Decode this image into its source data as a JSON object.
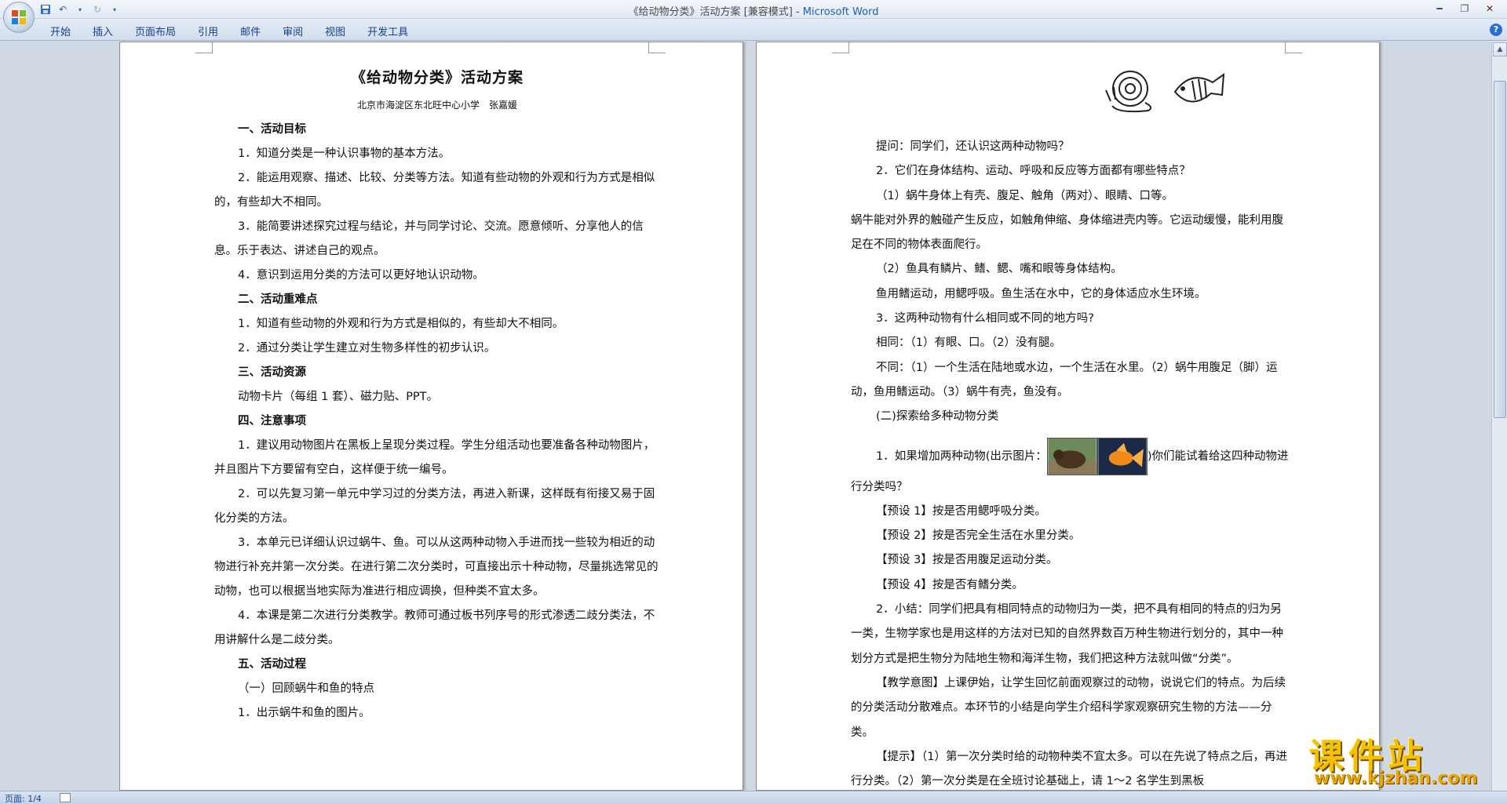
{
  "window": {
    "title_doc": "《给动物分类》活动方案 [兼容模式] - ",
    "title_app": "Microsoft Word"
  },
  "ribbon": {
    "tabs": [
      "开始",
      "插入",
      "页面布局",
      "引用",
      "邮件",
      "审阅",
      "视图",
      "开发工具"
    ]
  },
  "page1": {
    "title": "《给动物分类》活动方案",
    "author": "北京市海淀区东北旺中心小学　张嘉媛",
    "lines": [
      {
        "t": "一、活动目标",
        "k": "head"
      },
      {
        "t": "1．知道分类是一种认识事物的基本方法。",
        "k": "ind"
      },
      {
        "t": "2．能运用观察、描述、比较、分类等方法。知道有些动物的外观和行为方式是相似的，有些却大不相同。",
        "k": "ind"
      },
      {
        "t": "3．能简要讲述探究过程与结论，并与同学讨论、交流。愿意倾听、分享他人的信息。乐于表达、讲述自己的观点。",
        "k": "ind"
      },
      {
        "t": "4．意识到运用分类的方法可以更好地认识动物。",
        "k": "ind"
      },
      {
        "t": "二、活动重难点",
        "k": "head"
      },
      {
        "t": "1．知道有些动物的外观和行为方式是相似的，有些却大不相同。",
        "k": "ind"
      },
      {
        "t": "2．通过分类让学生建立对生物多样性的初步认识。",
        "k": "ind"
      },
      {
        "t": "三、活动资源",
        "k": "head"
      },
      {
        "t": "动物卡片（每组 1 套）、磁力贴、PPT。",
        "k": "ind"
      },
      {
        "t": "四、注意事项",
        "k": "head"
      },
      {
        "t": "1．建议用动物图片在黑板上呈现分类过程。学生分组活动也要准备各种动物图片，并且图片下方要留有空白，这样便于统一编号。",
        "k": "ind"
      },
      {
        "t": "2．可以先复习第一单元中学习过的分类方法，再进入新课，这样既有衔接又易于固化分类的方法。",
        "k": "ind"
      },
      {
        "t": "3．本单元已详细认识过蜗牛、鱼。可以从这两种动物入手进而找一些较为相近的动物进行补充并第一次分类。在进行第二次分类时，可直接出示十种动物，尽量挑选常见的动物，也可以根据当地实际为准进行相应调换，但种类不宜太多。",
        "k": "ind"
      },
      {
        "t": "4．本课是第二次进行分类教学。教师可通过板书列序号的形式渗透二歧分类法，不用讲解什么是二歧分类。",
        "k": "ind"
      },
      {
        "t": "五、活动过程",
        "k": "head"
      },
      {
        "t": "（一）回顾蜗牛和鱼的特点",
        "k": "ind"
      },
      {
        "t": "1．出示蜗牛和鱼的图片。",
        "k": "ind"
      }
    ]
  },
  "page2": {
    "lines": [
      {
        "t": "提问：同学们，还认识这两种动物吗？",
        "k": "ind"
      },
      {
        "t": "2．它们在身体结构、运动、呼吸和反应等方面都有哪些特点？",
        "k": "ind"
      },
      {
        "t": "（1）蜗牛身体上有壳、腹足、触角（两对）、眼睛、口等。",
        "k": "ind"
      },
      {
        "t": "蜗牛能对外界的触碰产生反应，如触角伸缩、身体缩进壳内等。它运动缓慢，能利用腹足在不同的物体表面爬行。",
        "k": "none"
      },
      {
        "t": "（2）鱼具有鳞片、鳍、鳃、嘴和眼等身体结构。",
        "k": "ind"
      },
      {
        "t": "鱼用鳍运动，用鳃呼吸。鱼生活在水中，它的身体适应水生环境。",
        "k": "ind"
      },
      {
        "t": "3．这两种动物有什么相同或不同的地方吗?",
        "k": "ind"
      },
      {
        "t": "相同：（1）有眼、口。（2）没有腿。",
        "k": "ind"
      },
      {
        "t": "不同：（1）一个生活在陆地或水边，一个生活在水里。（2）蜗牛用腹足（脚）运动，鱼用鳍运动。（3）蜗牛有壳，鱼没有。",
        "k": "ind"
      },
      {
        "t": "(二)探索给多种动物分类",
        "k": "ind"
      }
    ],
    "q1_before": "1．如果增加两种动物(出示图片：",
    "q1_after": ")你们能试着给这四种动物进行分类吗？",
    "lines2": [
      {
        "t": "【预设 1】按是否用鳃呼吸分类。",
        "k": "ind"
      },
      {
        "t": "【预设 2】按是否完全生活在水里分类。",
        "k": "ind"
      },
      {
        "t": "【预设 3】按是否用腹足运动分类。",
        "k": "ind"
      },
      {
        "t": "【预设 4】按是否有鳍分类。",
        "k": "ind"
      },
      {
        "t": "2．小结：同学们把具有相同特点的动物归为一类，把不具有相同的特点的归为另一类，生物学家也是用这样的方法对已知的自然界数百万种生物进行划分的，其中一种划分方式是把生物分为陆地生物和海洋生物，我们把这种方法就叫做“分类”。",
        "k": "ind"
      },
      {
        "t": "【教学意图】上课伊始，让学生回忆前面观察过的动物，说说它们的特点。为后续的分类活动分散难点。本环节的小结是向学生介绍科学家观察研究生物的方法——分类。",
        "k": "ind"
      },
      {
        "t": "【提示】（1）第一次分类时给的动物种类不宜太多。可以在先说了特点之后，再进行分类。（2）第一次分类是在全班讨论基础上，请 1～2 名学生到黑板",
        "k": "ind"
      }
    ]
  },
  "status": {
    "page": "页面: 1/4"
  },
  "watermark": {
    "main": "课件站",
    "url": "www.kjzhan.com"
  }
}
